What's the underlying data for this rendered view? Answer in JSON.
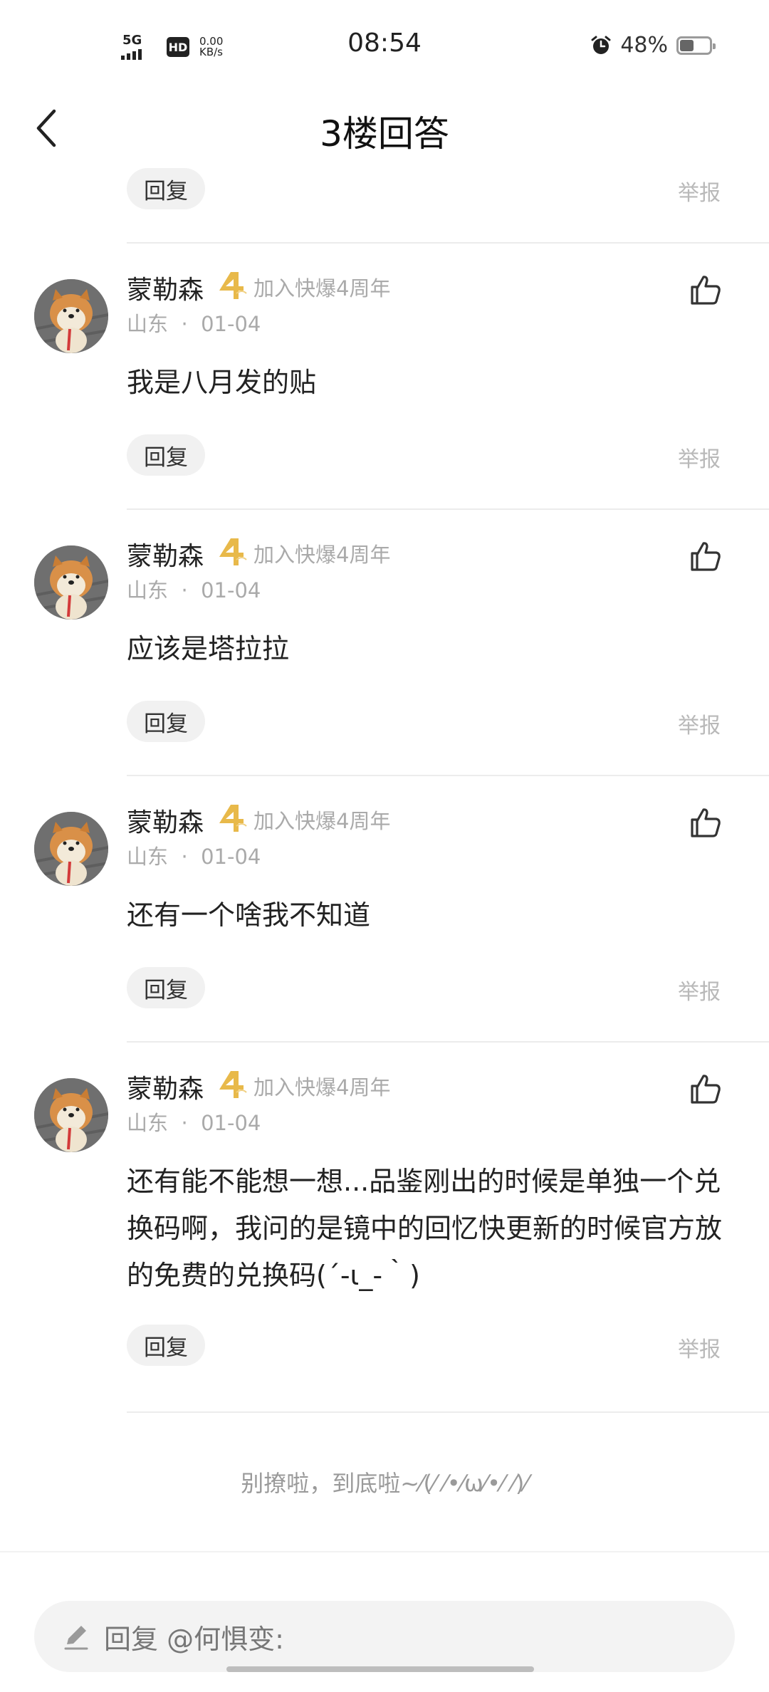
{
  "status_bar": {
    "network": "5G",
    "hd": "HD",
    "speed_value": "0.00",
    "speed_unit": "KB/s",
    "time": "08:54",
    "battery": "48%",
    "battery_level": 0.48
  },
  "header": {
    "title": "3楼回答"
  },
  "actions": {
    "reply_label": "回复",
    "report_label": "举报"
  },
  "comments": [
    {
      "user": "蒙勒森",
      "badge": "加入快爆4周年",
      "location": "山东",
      "separator": "·",
      "date": "01-04",
      "text": "我是八月发的贴"
    },
    {
      "user": "蒙勒森",
      "badge": "加入快爆4周年",
      "location": "山东",
      "separator": "·",
      "date": "01-04",
      "text": "应该是塔拉拉"
    },
    {
      "user": "蒙勒森",
      "badge": "加入快爆4周年",
      "location": "山东",
      "separator": "·",
      "date": "01-04",
      "text": "还有一个啥我不知道"
    },
    {
      "user": "蒙勒森",
      "badge": "加入快爆4周年",
      "location": "山东",
      "separator": "·",
      "date": "01-04",
      "text": "还有能不能想一想...品鉴刚出的时候是单独一个兑换码啊，我问的是镜中的回忆快更新的时候官方放的免费的兑换码(´-ι_-｀)"
    }
  ],
  "end_note": "别撩啦，到底啦~⁄(⁄ ⁄•⁄ω⁄•⁄ ⁄)⁄",
  "reply_box": {
    "placeholder": "回复 @何惧变:"
  },
  "colors": {
    "badge_gold": "#e8b94a",
    "muted": "#aaaaaa"
  }
}
